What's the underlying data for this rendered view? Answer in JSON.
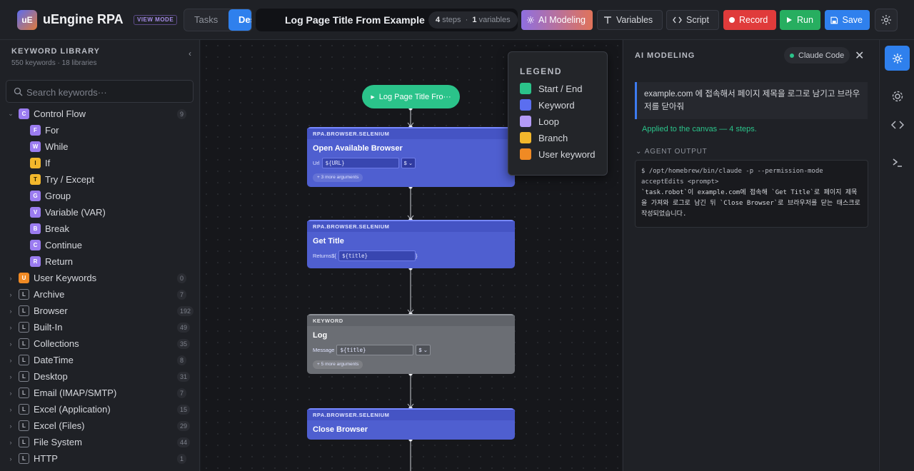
{
  "app": {
    "logo": "uE",
    "title": "uEngine RPA",
    "view_mode": "VIEW MODE"
  },
  "tabs": {
    "tasks": "Tasks",
    "design": "Des"
  },
  "flow": {
    "title": "Log Page Title From Example",
    "steps_num": "4",
    "steps_label": "steps",
    "vars_num": "1",
    "vars_label": "variables"
  },
  "toolbar": {
    "ai_modeling": "AI Modeling",
    "variables": "Variables",
    "script": "Script",
    "record": "Record",
    "run": "Run",
    "save": "Save"
  },
  "library": {
    "title": "KEYWORD LIBRARY",
    "subtitle": "550 keywords · 18 libraries",
    "search_placeholder": "Search keywords···",
    "control_flow": {
      "badge": "C",
      "label": "Control Flow",
      "count": "9"
    },
    "control_children": [
      {
        "badge": "F",
        "label": "For",
        "color": "purple"
      },
      {
        "badge": "W",
        "label": "While",
        "color": "purple"
      },
      {
        "badge": "I",
        "label": "If",
        "color": "yellow"
      },
      {
        "badge": "T",
        "label": "Try / Except",
        "color": "yellow"
      },
      {
        "badge": "G",
        "label": "Group",
        "color": "purple"
      },
      {
        "badge": "V",
        "label": "Variable (VAR)",
        "color": "purple"
      },
      {
        "badge": "B",
        "label": "Break",
        "color": "purple"
      },
      {
        "badge": "C",
        "label": "Continue",
        "color": "purple"
      },
      {
        "badge": "R",
        "label": "Return",
        "color": "purple"
      }
    ],
    "libraries": [
      {
        "badge": "U",
        "label": "User Keywords",
        "count": "0",
        "color": "orange"
      },
      {
        "badge": "L",
        "label": "Archive",
        "count": "7",
        "color": "outline"
      },
      {
        "badge": "L",
        "label": "Browser",
        "count": "192",
        "color": "outline"
      },
      {
        "badge": "L",
        "label": "Built-In",
        "count": "49",
        "color": "outline"
      },
      {
        "badge": "L",
        "label": "Collections",
        "count": "35",
        "color": "outline"
      },
      {
        "badge": "L",
        "label": "DateTime",
        "count": "8",
        "color": "outline"
      },
      {
        "badge": "L",
        "label": "Desktop",
        "count": "31",
        "color": "outline"
      },
      {
        "badge": "L",
        "label": "Email (IMAP/SMTP)",
        "count": "7",
        "color": "outline"
      },
      {
        "badge": "L",
        "label": "Excel (Application)",
        "count": "15",
        "color": "outline"
      },
      {
        "badge": "L",
        "label": "Excel (Files)",
        "count": "29",
        "color": "outline"
      },
      {
        "badge": "L",
        "label": "File System",
        "count": "44",
        "color": "outline"
      },
      {
        "badge": "L",
        "label": "HTTP",
        "count": "1",
        "color": "outline"
      }
    ]
  },
  "canvas": {
    "start": {
      "label": "Log Page Title Fro···"
    },
    "nodes": {
      "open_browser": {
        "lib": "RPA.BROWSER.SELENIUM",
        "name": "Open Available Browser",
        "arg_label": "Url",
        "arg_value": "${URL}",
        "arg_type": "$",
        "more": "+ 3 more arguments"
      },
      "get_title": {
        "lib": "RPA.BROWSER.SELENIUM",
        "name": "Get Title",
        "arg_label": "Returns",
        "arg_open": "${",
        "arg_value": "${title}",
        "arg_close": "}"
      },
      "log": {
        "lib": "KEYWORD",
        "name": "Log",
        "arg_label": "Message",
        "arg_value": "${title}",
        "arg_type": "$",
        "more": "+ 5 more arguments"
      },
      "close_browser": {
        "lib": "RPA.BROWSER.SELENIUM",
        "name": "Close Browser"
      }
    },
    "legend": {
      "title": "LEGEND",
      "items": [
        {
          "label": "Start / End",
          "color": "#2bc38a"
        },
        {
          "label": "Keyword",
          "color": "#5b6ef0"
        },
        {
          "label": "Loop",
          "color": "#b39af5"
        },
        {
          "label": "Branch",
          "color": "#f2b72c"
        },
        {
          "label": "User keyword",
          "color": "#f08a24"
        }
      ]
    }
  },
  "ai_panel": {
    "title": "AI MODELING",
    "badge": "Claude Code",
    "prompt": "example.com 에 접속해서 페이지 제목을 로그로 남기고 브라우저를 닫아줘",
    "applied": "Applied to the canvas — 4 steps.",
    "agent_header": "AGENT OUTPUT",
    "agent_command": "$ /opt/homebrew/bin/claude -p --permission-mode acceptEdits <prompt>",
    "agent_output": "`task.robot`이 example.com에 접속해 `Get Title`로 페이지 제목을 가져와 로그로 남긴 뒤 `Close Browser`로 브라우저를 닫는 태스크로 작성되었습니다."
  },
  "colors": {
    "accent": "#2f80ed",
    "start": "#2bc38a",
    "keyword": "#4f5fd0",
    "record": "#e03b3b",
    "run": "#27ae60"
  },
  "icons": [
    "search-icon",
    "chevron-down-icon",
    "chevron-right-icon",
    "chevron-left-icon",
    "sparkle-icon",
    "text-icon",
    "code-icon",
    "play-icon",
    "save-icon",
    "gear-icon",
    "close-icon",
    "terminal-icon"
  ]
}
